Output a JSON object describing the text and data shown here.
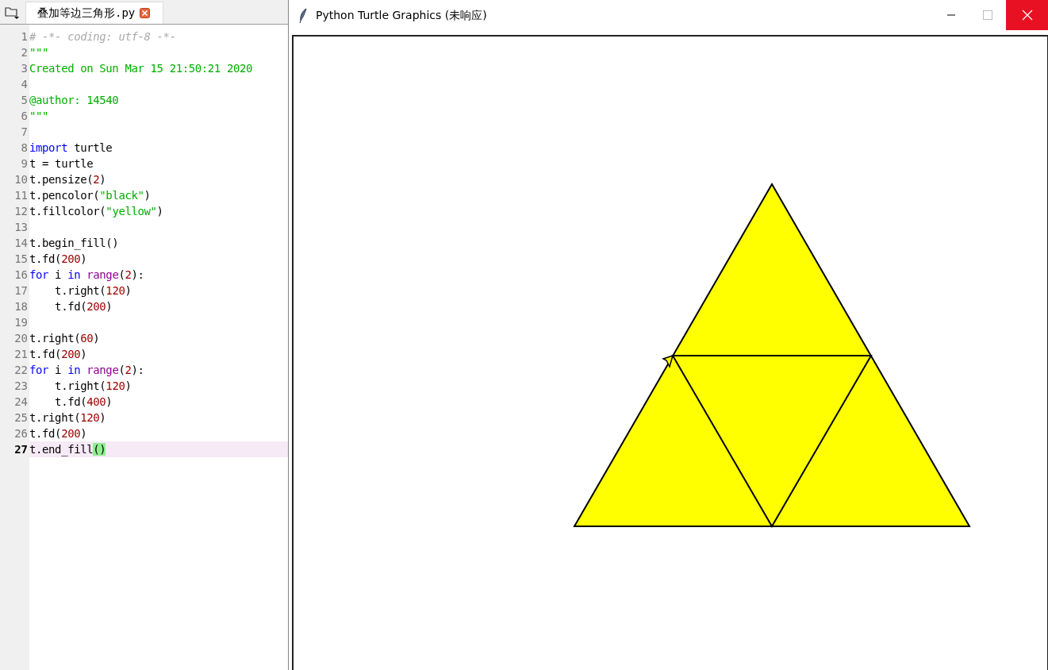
{
  "editor": {
    "tab": {
      "label": "叠加等边三角形.py",
      "selected": true
    },
    "lines": [
      {
        "number": "1",
        "current": false,
        "tokens": [
          {
            "kind": "comment",
            "text": "# -*- coding: utf-8 -*-"
          }
        ]
      },
      {
        "number": "2",
        "current": false,
        "tokens": [
          {
            "kind": "string",
            "text": "\"\"\""
          }
        ]
      },
      {
        "number": "3",
        "current": false,
        "tokens": [
          {
            "kind": "string",
            "text": "Created on Sun Mar 15 21:50:21 2020"
          }
        ]
      },
      {
        "number": "4",
        "current": false
      },
      {
        "number": "5",
        "current": false,
        "tokens": [
          {
            "kind": "string",
            "text": "@author: 14540"
          }
        ]
      },
      {
        "number": "6",
        "current": false,
        "tokens": [
          {
            "kind": "string",
            "text": "\"\"\""
          }
        ]
      },
      {
        "number": "7",
        "current": false
      },
      {
        "number": "8",
        "current": false,
        "tokens": [
          {
            "kind": "keyword",
            "text": "import"
          },
          {
            "kind": "plain",
            "text": " turtle"
          }
        ]
      },
      {
        "number": "9",
        "current": false,
        "tokens": [
          {
            "kind": "plain",
            "text": "t = turtle"
          }
        ]
      },
      {
        "number": "10",
        "current": false,
        "tokens": [
          {
            "kind": "plain",
            "text": "t.pensize("
          },
          {
            "kind": "number",
            "text": "2"
          },
          {
            "kind": "plain",
            "text": ")"
          }
        ]
      },
      {
        "number": "11",
        "current": false,
        "tokens": [
          {
            "kind": "plain",
            "text": "t.pencolor("
          },
          {
            "kind": "string",
            "text": "\"black\""
          },
          {
            "kind": "plain",
            "text": ")"
          }
        ]
      },
      {
        "number": "12",
        "current": false,
        "tokens": [
          {
            "kind": "plain",
            "text": "t.fillcolor("
          },
          {
            "kind": "string",
            "text": "\"yellow\""
          },
          {
            "kind": "plain",
            "text": ")"
          }
        ]
      },
      {
        "number": "13",
        "current": false
      },
      {
        "number": "14",
        "current": false,
        "tokens": [
          {
            "kind": "plain",
            "text": "t.begin_fill()"
          }
        ]
      },
      {
        "number": "15",
        "current": false,
        "tokens": [
          {
            "kind": "plain",
            "text": "t.fd("
          },
          {
            "kind": "number",
            "text": "200"
          },
          {
            "kind": "plain",
            "text": ")"
          }
        ]
      },
      {
        "number": "16",
        "current": false,
        "tokens": [
          {
            "kind": "keyword",
            "text": "for"
          },
          {
            "kind": "plain",
            "text": " i "
          },
          {
            "kind": "keyword",
            "text": "in "
          },
          {
            "kind": "builtin",
            "text": "range"
          },
          {
            "kind": "plain",
            "text": "("
          },
          {
            "kind": "number",
            "text": "2"
          },
          {
            "kind": "plain",
            "text": "):"
          }
        ]
      },
      {
        "number": "17",
        "current": false,
        "tokens": [
          {
            "kind": "plain",
            "text": "    t.right("
          },
          {
            "kind": "number",
            "text": "120"
          },
          {
            "kind": "plain",
            "text": ")"
          }
        ]
      },
      {
        "number": "18",
        "current": false,
        "tokens": [
          {
            "kind": "plain",
            "text": "    t.fd("
          },
          {
            "kind": "number",
            "text": "200"
          },
          {
            "kind": "plain",
            "text": ")"
          }
        ]
      },
      {
        "number": "19",
        "current": false
      },
      {
        "number": "20",
        "current": false,
        "tokens": [
          {
            "kind": "plain",
            "text": "t.right("
          },
          {
            "kind": "number",
            "text": "60"
          },
          {
            "kind": "plain",
            "text": ")"
          }
        ]
      },
      {
        "number": "21",
        "current": false,
        "tokens": [
          {
            "kind": "plain",
            "text": "t.fd("
          },
          {
            "kind": "number",
            "text": "200"
          },
          {
            "kind": "plain",
            "text": ")"
          }
        ]
      },
      {
        "number": "22",
        "current": false,
        "tokens": [
          {
            "kind": "keyword",
            "text": "for"
          },
          {
            "kind": "plain",
            "text": " i "
          },
          {
            "kind": "keyword",
            "text": "in "
          },
          {
            "kind": "builtin",
            "text": "range"
          },
          {
            "kind": "plain",
            "text": "("
          },
          {
            "kind": "number",
            "text": "2"
          },
          {
            "kind": "plain",
            "text": "):"
          }
        ]
      },
      {
        "number": "23",
        "current": false,
        "tokens": [
          {
            "kind": "plain",
            "text": "    t.right("
          },
          {
            "kind": "number",
            "text": "120"
          },
          {
            "kind": "plain",
            "text": ")"
          }
        ]
      },
      {
        "number": "24",
        "current": false,
        "tokens": [
          {
            "kind": "plain",
            "text": "    t.fd("
          },
          {
            "kind": "number",
            "text": "400"
          },
          {
            "kind": "plain",
            "text": ")"
          }
        ]
      },
      {
        "number": "25",
        "current": false,
        "tokens": [
          {
            "kind": "plain",
            "text": "t.right("
          },
          {
            "kind": "number",
            "text": "120"
          },
          {
            "kind": "plain",
            "text": ")"
          }
        ]
      },
      {
        "number": "26",
        "current": false,
        "tokens": [
          {
            "kind": "plain",
            "text": "t.fd("
          },
          {
            "kind": "number",
            "text": "200"
          },
          {
            "kind": "plain",
            "text": ")"
          }
        ]
      },
      {
        "number": "27",
        "current": true,
        "tokens": [
          {
            "kind": "plain",
            "text": "t.end_fill"
          },
          {
            "kind": "match",
            "text": "()"
          }
        ]
      }
    ]
  },
  "window": {
    "title": "Python Turtle Graphics (未响应)"
  }
}
